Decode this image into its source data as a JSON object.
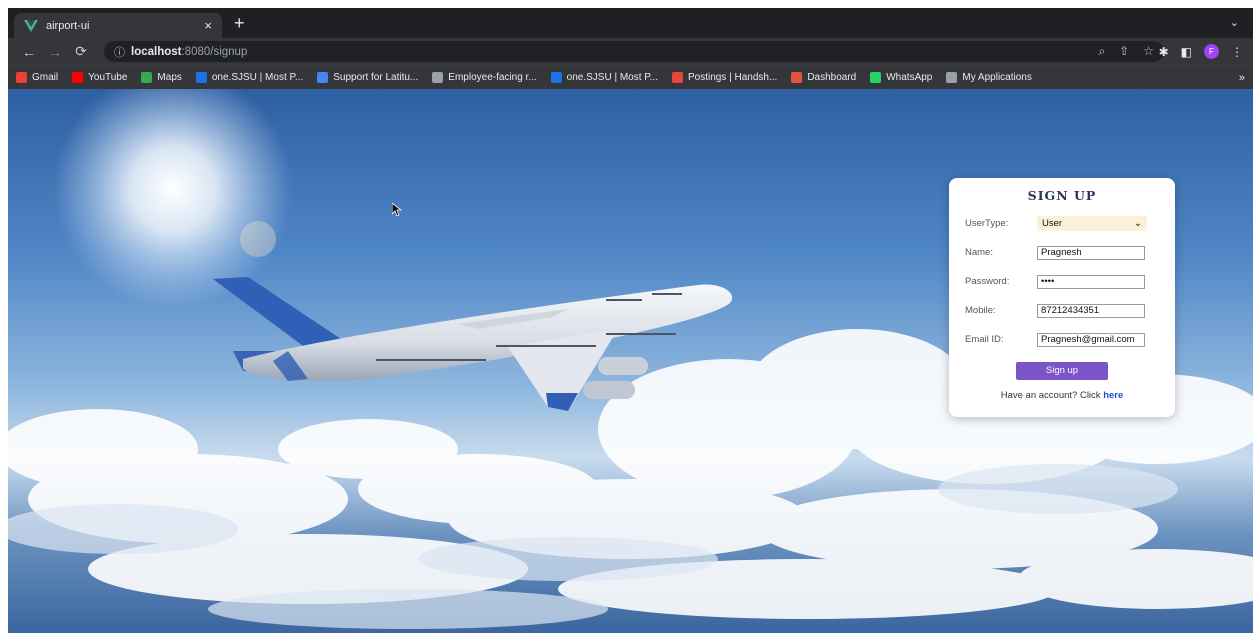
{
  "browser": {
    "tab_title": "airport-ui",
    "tab_close": "×",
    "new_tab": "+",
    "url_host": "localhost",
    "url_path": ":8080/signup",
    "profile_initial": "F",
    "bookmarks": [
      {
        "label": "Gmail",
        "color": "#ea4335"
      },
      {
        "label": "YouTube",
        "color": "#ff0000"
      },
      {
        "label": "Maps",
        "color": "#34a853"
      },
      {
        "label": "one.SJSU | Most P...",
        "color": "#1a73e8"
      },
      {
        "label": "Support for Latitu...",
        "color": "#4285f4"
      },
      {
        "label": "Employee-facing r...",
        "color": "#9aa0a6"
      },
      {
        "label": "one.SJSU | Most P...",
        "color": "#1a73e8"
      },
      {
        "label": "Postings | Handsh...",
        "color": "#e8453c"
      },
      {
        "label": "Dashboard",
        "color": "#e2553d"
      },
      {
        "label": "WhatsApp",
        "color": "#25d366"
      },
      {
        "label": "My Applications",
        "color": "#9aa0a6"
      }
    ],
    "bookmarks_more": "»"
  },
  "form": {
    "title": "SIGN UP",
    "usertype_label": "UserType:",
    "usertype_value": "User",
    "name_label": "Name:",
    "name_value": "Pragnesh",
    "password_label": "Password:",
    "password_value": "••••",
    "mobile_label": "Mobile:",
    "mobile_value": "87212434351",
    "email_label": "Email ID:",
    "email_value": "Pragnesh@gmail.com",
    "submit_label": "Sign up",
    "have_account_text": "Have an account? Click ",
    "here_link": "here"
  }
}
